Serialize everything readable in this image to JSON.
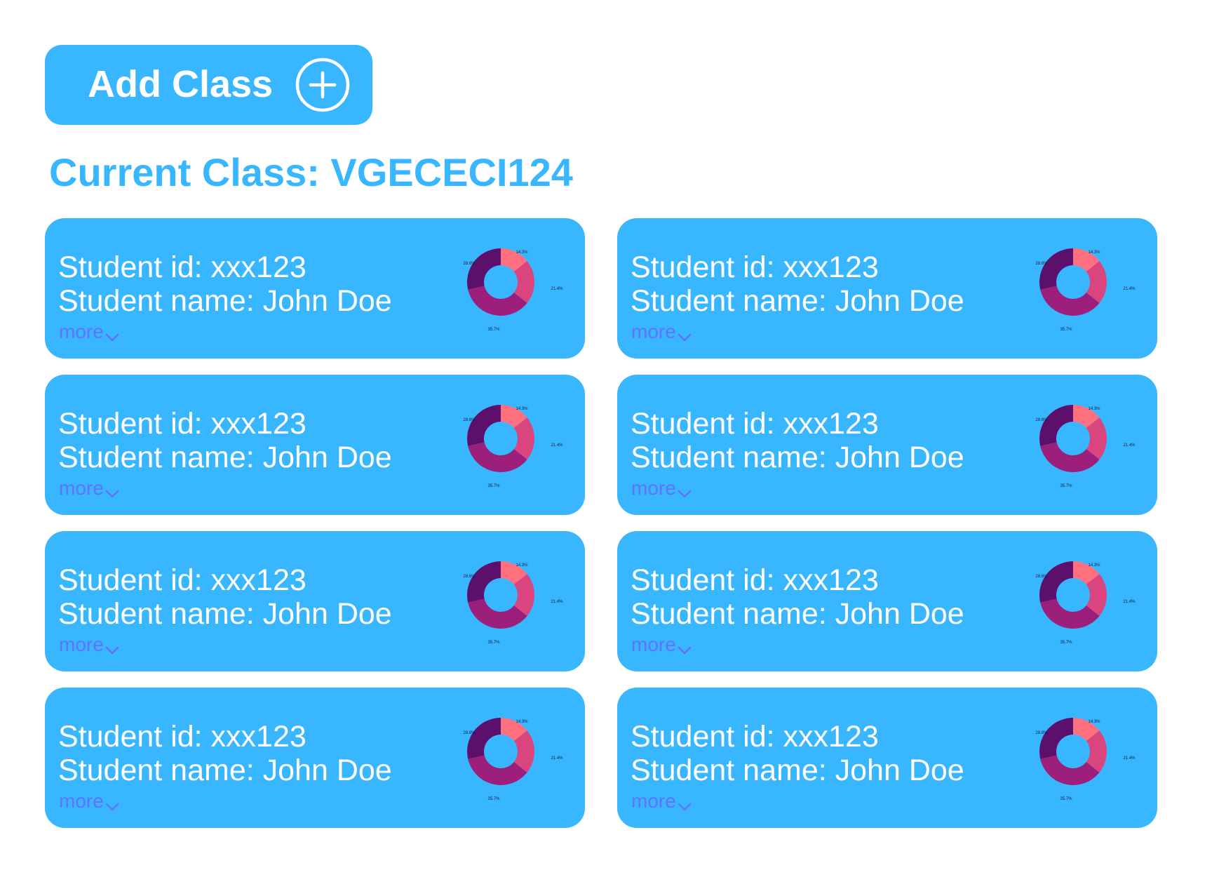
{
  "toolbar": {
    "add_class_label": "Add Class",
    "add_icon": "plus-circle-icon"
  },
  "current_class": {
    "label": "Current Class: VGECECI124"
  },
  "students": [
    {
      "id_text": "Student id: xxx123",
      "name_text": "Student name: John Doe",
      "more_label": "more"
    },
    {
      "id_text": "Student id: xxx123",
      "name_text": "Student name: John Doe",
      "more_label": "more"
    },
    {
      "id_text": "Student id: xxx123",
      "name_text": "Student name: John Doe",
      "more_label": "more"
    },
    {
      "id_text": "Student id: xxx123",
      "name_text": "Student name: John Doe",
      "more_label": "more"
    },
    {
      "id_text": "Student id: xxx123",
      "name_text": "Student name: John Doe",
      "more_label": "more"
    },
    {
      "id_text": "Student id: xxx123",
      "name_text": "Student name: John Doe",
      "more_label": "more"
    },
    {
      "id_text": "Student id: xxx123",
      "name_text": "Student name: John Doe",
      "more_label": "more"
    },
    {
      "id_text": "Student id: xxx123",
      "name_text": "Student name: John Doe",
      "more_label": "more"
    }
  ],
  "chart_data": {
    "type": "pie",
    "donut": true,
    "slices": [
      {
        "label": "14.3%",
        "value": 14.3,
        "color": "#ff6f7d"
      },
      {
        "label": "21.4%",
        "value": 21.4,
        "color": "#d9467f"
      },
      {
        "label": "35.7%",
        "value": 35.7,
        "color": "#9c1f7c"
      },
      {
        "label": "28.6%",
        "value": 28.6,
        "color": "#5c0f6b"
      }
    ]
  },
  "colors": {
    "accent": "#38b6ff",
    "card_text": "#ffffff",
    "more_link": "#5e73ff"
  }
}
